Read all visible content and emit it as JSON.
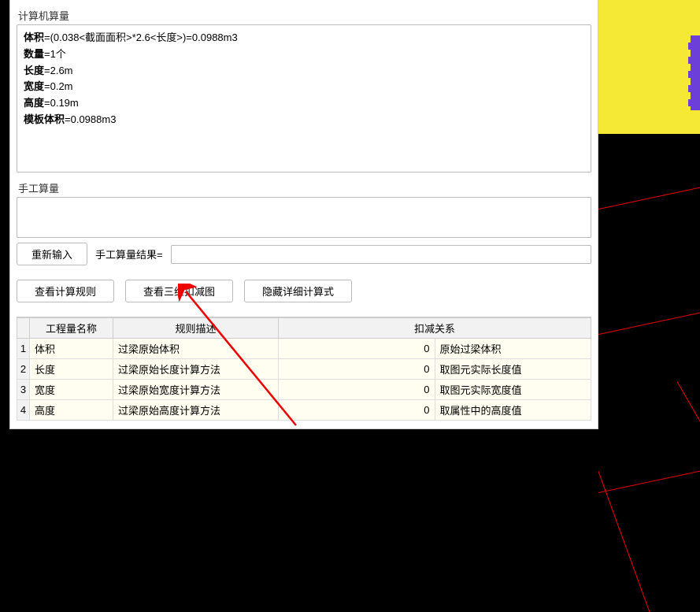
{
  "sections": {
    "computerCalcLabel": "计算机算量",
    "manualCalcLabel": "手工算量"
  },
  "calc": {
    "lines": [
      {
        "label": "体积",
        "expr": "=(0.038<截面面积>*2.6<长度>)=0.0988m3"
      },
      {
        "label": "数量",
        "expr": "=1个"
      },
      {
        "label": "长度",
        "expr": "=2.6m"
      },
      {
        "label": "宽度",
        "expr": "=0.2m"
      },
      {
        "label": "高度",
        "expr": "=0.19m"
      },
      {
        "label": "模板体积",
        "expr": "=0.0988m3"
      }
    ]
  },
  "manual": {
    "reinputLabel": "重新输入",
    "resultLabel": "手工算量结果=",
    "resultValue": ""
  },
  "buttons": {
    "viewRules": "查看计算规则",
    "view3d": "查看三维扣减图",
    "hideDetail": "隐藏详细计算式"
  },
  "table": {
    "headers": {
      "name": "工程量名称",
      "rule": "规则描述",
      "deduction": "扣减关系"
    },
    "rows": [
      {
        "idx": "1",
        "name": "体积",
        "rule": "过梁原始体积",
        "zero": "0",
        "ded": "原始过梁体积"
      },
      {
        "idx": "2",
        "name": "长度",
        "rule": "过梁原始长度计算方法",
        "zero": "0",
        "ded": "取图元实际长度值"
      },
      {
        "idx": "3",
        "name": "宽度",
        "rule": "过梁原始宽度计算方法",
        "zero": "0",
        "ded": "取图元实际宽度值"
      },
      {
        "idx": "4",
        "name": "高度",
        "rule": "过梁原始高度计算方法",
        "zero": "0",
        "ded": "取属性中的高度值"
      }
    ]
  }
}
